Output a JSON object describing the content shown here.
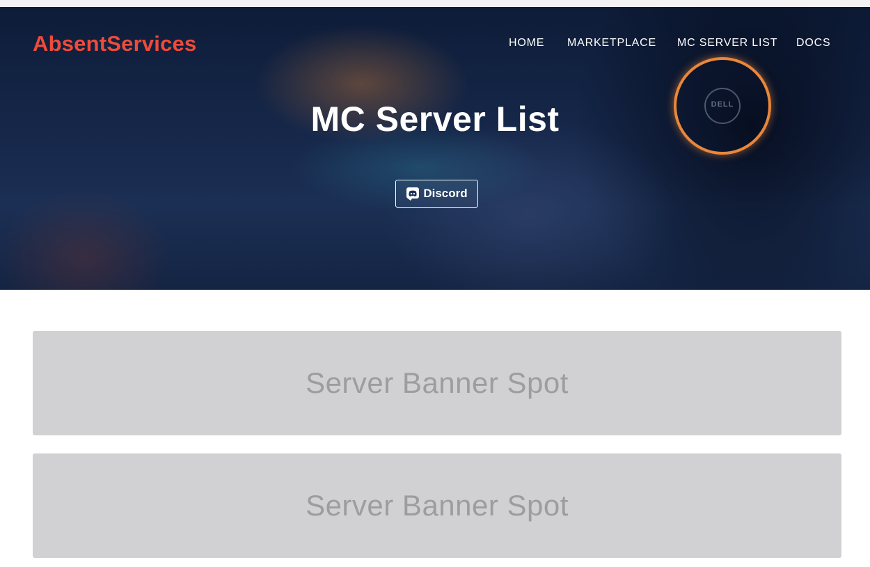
{
  "brand": {
    "name": "AbsentServices",
    "color": "#ef4b3a"
  },
  "nav": {
    "items": [
      {
        "label": "HOME"
      },
      {
        "label": "MARKETPLACE"
      },
      {
        "label": "MC SERVER LIST"
      },
      {
        "label": "DOCS"
      }
    ]
  },
  "hero": {
    "title": "MC Server List",
    "button_label": "Discord",
    "button_icon": "discord-icon",
    "headphone_brand": "DELL",
    "accent_ring_color": "#e9873a"
  },
  "banners": [
    {
      "text": "Server Banner Spot"
    },
    {
      "text": "Server Banner Spot"
    }
  ]
}
